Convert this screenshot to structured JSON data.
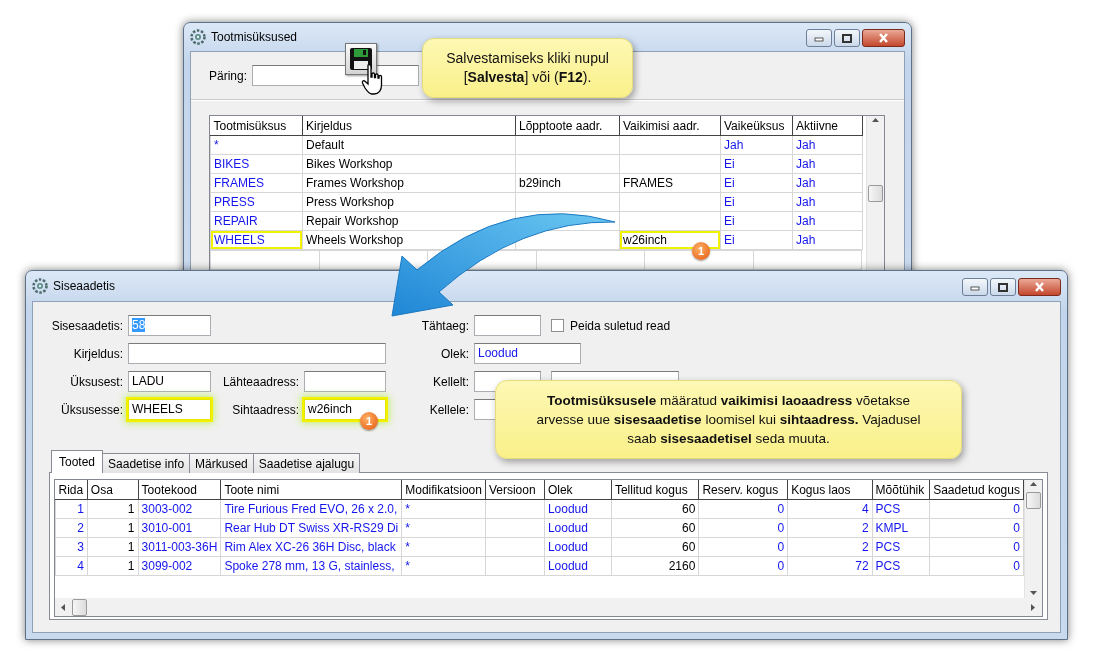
{
  "top_window": {
    "title": "Tootmisüksused",
    "query": {
      "label": "Päring:"
    },
    "table": {
      "columns": [
        {
          "label": "Tootmisüksus",
          "link": true
        },
        {
          "label": "Kirjeldus",
          "link": false
        },
        {
          "label": "Lõpptoote aadr.",
          "link": false
        },
        {
          "label": "Vaikimisi aadr.",
          "link": false
        },
        {
          "label": "Vaikeüksus",
          "link": true
        },
        {
          "label": "Aktiivne",
          "link": true
        }
      ],
      "rows": [
        [
          "*",
          "Default",
          null,
          null,
          "Jah",
          "Jah"
        ],
        [
          "BIKES",
          "Bikes Workshop",
          null,
          null,
          "Ei",
          "Jah"
        ],
        [
          "FRAMES",
          "Frames Workshop",
          "b29inch",
          "FRAMES",
          "Ei",
          "Jah"
        ],
        [
          "PRESS",
          "Press Workshop",
          null,
          null,
          "Ei",
          "Jah"
        ],
        [
          "REPAIR",
          "Repair Workshop",
          null,
          null,
          "Ei",
          "Jah"
        ],
        [
          {
            "text": "WHEELS",
            "highlighted": true
          },
          "Wheels Workshop",
          null,
          {
            "text": "w26inch",
            "highlighted": true,
            "badge": "1"
          },
          "Ei",
          "Jah"
        ]
      ]
    }
  },
  "callouts": [
    {
      "text": "Salvestamiseks kliki nupul [**Salvesta**] või (**F12**)."
    },
    {
      "text": "**Tootmisüksusele** määratud **vaikimisi laoaadress** võetakse arvesse uue **sisesaadetise** loomisel kui **sihtaadress.** Vajadusel saab **sisesaadetisel** seda muuta."
    }
  ],
  "bottom_window": {
    "title": "Siseaadetis",
    "form": {
      "document": {
        "label": "Sisesaadetis:",
        "value": "58",
        "value_selected": true
      },
      "due_date": {
        "label": "Tähtaeg:"
      },
      "hide_closed": {
        "label": "Peida suletud read",
        "checked": false
      },
      "description": {
        "label": "Kirjeldus:"
      },
      "status": {
        "label": "Olek:",
        "value": "Loodud"
      },
      "from_unit": {
        "label": "Üksusest:",
        "value": "LADU"
      },
      "source_address": {
        "label": "Lähteaadress:"
      },
      "from_person": {
        "label": "Kellelt:"
      },
      "to_unit": {
        "label": "Üksusesse:",
        "value": "WHEELS",
        "highlighted": true
      },
      "target_address": {
        "label": "Sihtaadress:",
        "value": "w26inch",
        "highlighted": true,
        "badge": "1"
      },
      "to_person": {
        "label": "Kellele:"
      }
    },
    "tabs": [
      {
        "label": "Tooted",
        "selected": true
      },
      {
        "label": "Saadetise info",
        "selected": false
      },
      {
        "label": "Märkused",
        "selected": false
      },
      {
        "label": "Saadetise ajalugu",
        "selected": false
      }
    ],
    "table": {
      "columns": [
        {
          "label": "Rida",
          "kind": "number",
          "link": true
        },
        {
          "label": "Osa",
          "kind": "number",
          "link": false
        },
        {
          "label": "Tootekood",
          "kind": "text",
          "link": true
        },
        {
          "label": "Toote nimi",
          "kind": "text",
          "link": true
        },
        {
          "label": "Modifikatsioon",
          "kind": "text",
          "link": true
        },
        {
          "label": "Versioon"
        },
        {
          "label": "Olek",
          "kind": "text",
          "link": true
        },
        {
          "label": "Tellitud kogus",
          "kind": "number",
          "link": false
        },
        {
          "label": "Reserv. kogus",
          "kind": "number",
          "link": true
        },
        {
          "label": "Kogus laos",
          "kind": "number",
          "link": true
        },
        {
          "label": "Mõõtühik",
          "kind": "text",
          "link": true
        },
        {
          "label": "Saadetud kogus",
          "kind": "number",
          "link": true
        }
      ],
      "rows": [
        [
          "1",
          "1",
          "3003-002",
          "Tire Furious Fred EVO, 26 x 2.0,",
          "*",
          null,
          "Loodud",
          "60",
          "0",
          "4",
          "PCS",
          "0"
        ],
        [
          "2",
          "1",
          "3010-001",
          "Rear Hub DT Swiss XR-RS29 Di",
          "*",
          null,
          "Loodud",
          "60",
          "0",
          "2",
          "KMPL",
          "0"
        ],
        [
          "3",
          "1",
          "3011-003-36H",
          "Rim Alex XC-26 36H Disc, black",
          "*",
          null,
          "Loodud",
          "60",
          "0",
          "2",
          "PCS",
          "0"
        ],
        [
          "4",
          "1",
          "3099-002",
          "Spoke 278 mm, 13 G, stainless,",
          "*",
          null,
          "Loodud",
          "2160",
          "0",
          "72",
          "PCS",
          "0"
        ]
      ]
    }
  }
}
